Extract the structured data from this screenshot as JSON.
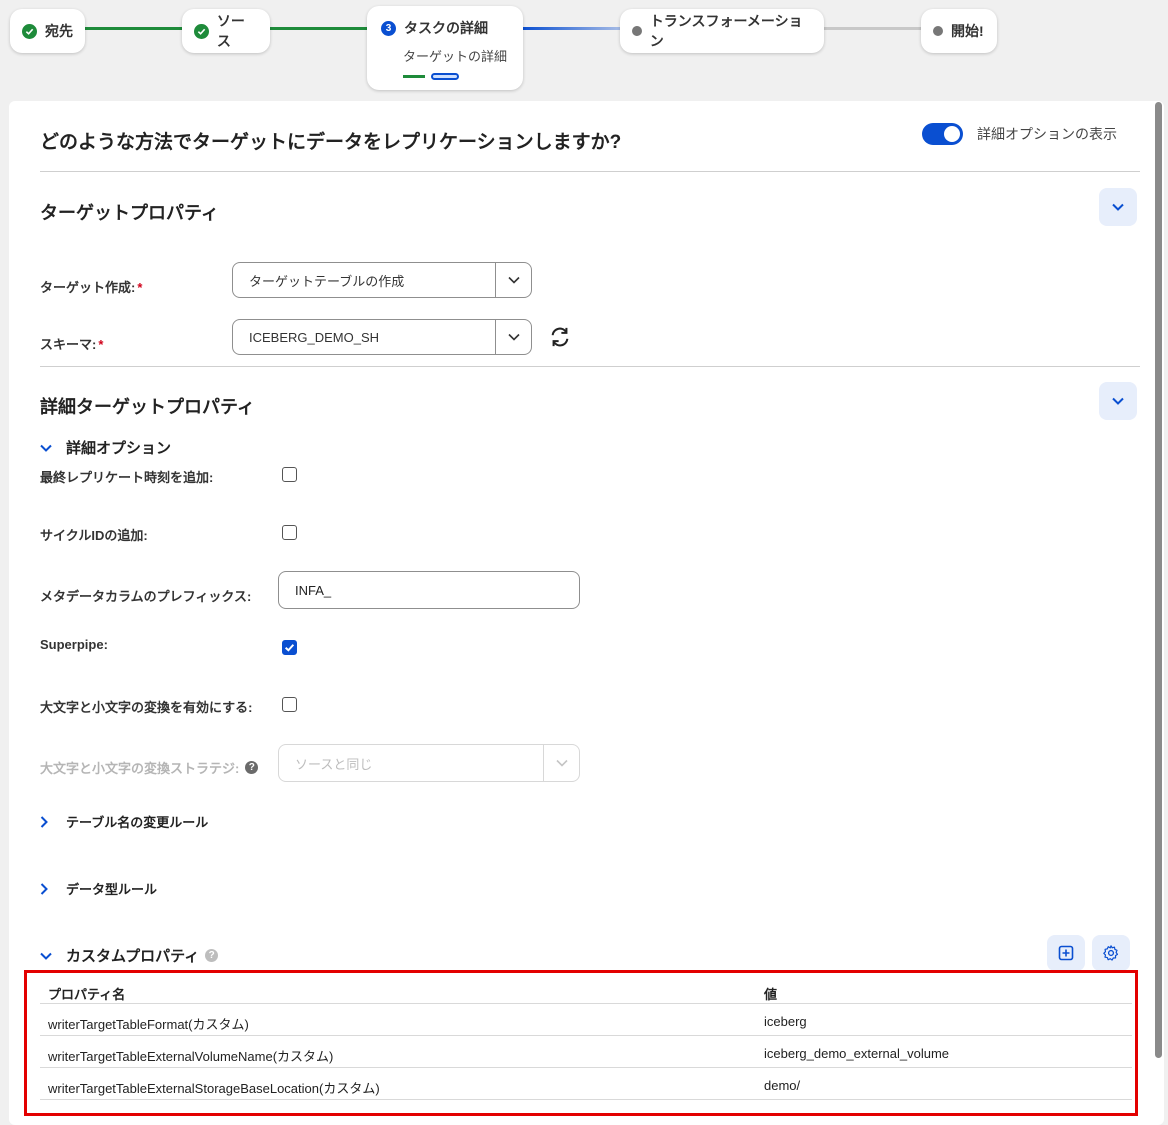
{
  "stepper": {
    "steps": [
      {
        "label": "宛先",
        "state": "done"
      },
      {
        "label": "ソース",
        "state": "done"
      },
      {
        "label": "タスクの詳細",
        "state": "active",
        "number": "3",
        "sub_label": "ターゲットの詳細"
      },
      {
        "label": "トランスフォーメーション",
        "state": "pending"
      },
      {
        "label": "開始!",
        "state": "pending"
      }
    ]
  },
  "header": {
    "question": "どのような方法でターゲットにデータをレプリケーションしますか?",
    "advanced_toggle_label": "詳細オプションの表示",
    "advanced_toggle_on": true
  },
  "target_properties": {
    "title": "ターゲットプロパティ",
    "target_creation": {
      "label": "ターゲット作成:",
      "value": "ターゲットテーブルの作成"
    },
    "schema": {
      "label": "スキーマ:",
      "value": "ICEBERG_DEMO_SH"
    }
  },
  "advanced_target_properties": {
    "title": "詳細ターゲットプロパティ",
    "advanced_options_title": "詳細オプション",
    "add_last_replicated_time": {
      "label": "最終レプリケート時刻を追加:",
      "checked": false
    },
    "add_cycle_id": {
      "label": "サイクルIDの追加:",
      "checked": false
    },
    "metadata_column_prefix": {
      "label": "メタデータカラムのプレフィックス:",
      "value": "INFA_"
    },
    "superpipe": {
      "label": "Superpipe:",
      "checked": true
    },
    "enable_case_conversion": {
      "label": "大文字と小文字の変換を有効にする:",
      "checked": false
    },
    "case_conversion_strategy": {
      "label": "大文字と小文字の変換ストラテジ:",
      "value": "ソースと同じ",
      "disabled": true
    },
    "table_rename_rules": "テーブル名の変更ルール",
    "data_type_rules": "データ型ルール",
    "custom_properties": {
      "title": "カスタムプロパティ",
      "columns": [
        "プロパティ名",
        "値"
      ],
      "rows": [
        {
          "name": "writerTargetTableFormat(カスタム)",
          "value": "iceberg"
        },
        {
          "name": "writerTargetTableExternalVolumeName(カスタム)",
          "value": "iceberg_demo_external_volume"
        },
        {
          "name": "writerTargetTableExternalStorageBaseLocation(カスタム)",
          "value": "demo/"
        }
      ]
    }
  },
  "colors": {
    "accent": "#0a4fd1",
    "done": "#1e8b3a",
    "required": "#d0021b",
    "highlight": "#e30000"
  }
}
